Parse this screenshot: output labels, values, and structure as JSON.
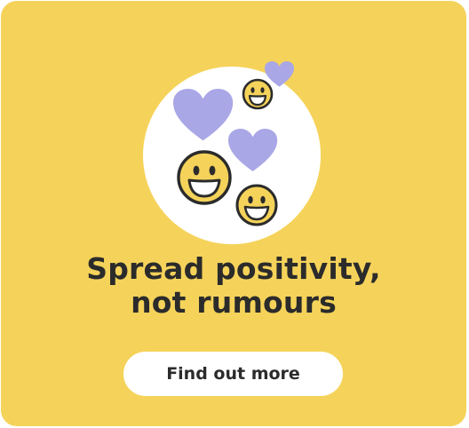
{
  "card": {
    "headline_line1": "Spread positivity,",
    "headline_line2": "not rumours",
    "cta_label": "Find out more"
  },
  "colors": {
    "background": "#F5D35A",
    "text": "#2B2B2B",
    "circle": "#FFFFFF",
    "heart": "#A9A7E6",
    "face": "#F5D35A",
    "button_bg": "#FFFFFF",
    "button_text": "#2B2B2B"
  },
  "icons": {
    "hearts": [
      "heart-icon",
      "heart-icon",
      "heart-icon"
    ],
    "faces": [
      "smiley-face-icon",
      "smiley-face-icon",
      "smiley-face-icon"
    ]
  }
}
